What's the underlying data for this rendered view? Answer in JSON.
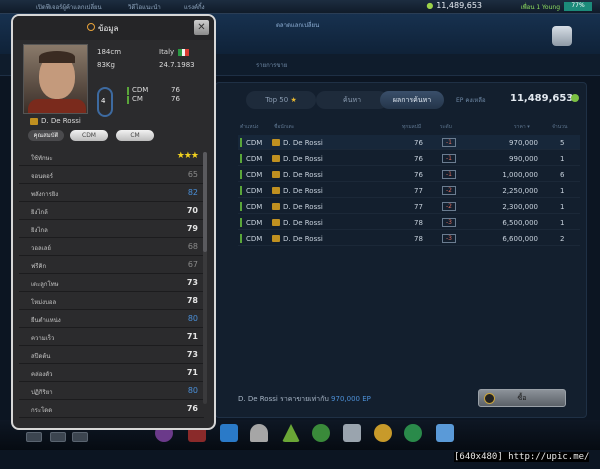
{
  "topbar": {
    "nav_left": "เปิดฟีเจอร์ผู้ค้าแลกเปลี่ยน",
    "nav_mid": "วิดีโอแนะนำ",
    "nav_right": "แรงค์กิ้ง",
    "coins": "11,489,653",
    "user": "เพื่อน 1 Young",
    "percent": "77%"
  },
  "header": {
    "title": "ตลาดแลกเปลี่ยน"
  },
  "subbar": {
    "label": "รายการขาย"
  },
  "popup": {
    "title": "ข้อมูล",
    "close": "✕",
    "player": {
      "name": "D. De Rossi",
      "height": "184cm",
      "weight": "83Kg",
      "country": "Italy",
      "birth": "24.7.1983",
      "number": "4",
      "pos1": "CDM",
      "pos1_val": "76",
      "pos2": "CM",
      "pos2_val": "76"
    },
    "tabs": [
      "คุณสมบัติ",
      "CDM",
      "CM"
    ],
    "stats": [
      {
        "label": "ใช้ทักษะ",
        "stars": "★★★"
      },
      {
        "label": "จอนตอร์",
        "value": "65",
        "style": "dim"
      },
      {
        "label": "พลังการยิง",
        "value": "82",
        "style": "blue"
      },
      {
        "label": "ยิงไกล้",
        "value": "70",
        "style": ""
      },
      {
        "label": "ยิงไกล",
        "value": "79",
        "style": ""
      },
      {
        "label": "วอลเลย์",
        "value": "68",
        "style": "dim"
      },
      {
        "label": "ฟรีคิก",
        "value": "67",
        "style": "dim"
      },
      {
        "label": "เตะลูกโทษ",
        "value": "73",
        "style": ""
      },
      {
        "label": "โหม่งบอล",
        "value": "78",
        "style": ""
      },
      {
        "label": "ยืนตำแหน่ง",
        "value": "80",
        "style": "blue"
      },
      {
        "label": "ความเร็ว",
        "value": "71",
        "style": ""
      },
      {
        "label": "สปีดต้น",
        "value": "73",
        "style": ""
      },
      {
        "label": "คล่องตัว",
        "value": "71",
        "style": ""
      },
      {
        "label": "ปฏิกิริยา",
        "value": "80",
        "style": "blue"
      },
      {
        "label": "กระโดด",
        "value": "76",
        "style": ""
      }
    ]
  },
  "market": {
    "tabs": [
      "Top 50",
      "ค้นหา",
      "ผลการค้นหา"
    ],
    "ep_label": "EP คงเหลือ",
    "ep_value": "11,489,653",
    "columns": [
      "ตำแหน่ง",
      "ชื่อนักเตะ",
      "ทุกมลปมี",
      "ระดับ",
      "ราคา ▾",
      "จำนวน"
    ],
    "rows": [
      {
        "pos": "CDM",
        "name": "D. De Rossi",
        "ovr": "76",
        "grade": "-1",
        "price": "970,000",
        "qty": "5"
      },
      {
        "pos": "CDM",
        "name": "D. De Rossi",
        "ovr": "76",
        "grade": "-1",
        "price": "990,000",
        "qty": "1"
      },
      {
        "pos": "CDM",
        "name": "D. De Rossi",
        "ovr": "76",
        "grade": "-1",
        "price": "1,000,000",
        "qty": "6"
      },
      {
        "pos": "CDM",
        "name": "D. De Rossi",
        "ovr": "77",
        "grade": "-2",
        "price": "2,250,000",
        "qty": "1"
      },
      {
        "pos": "CDM",
        "name": "D. De Rossi",
        "ovr": "77",
        "grade": "-2",
        "price": "2,300,000",
        "qty": "1"
      },
      {
        "pos": "CDM",
        "name": "D. De Rossi",
        "ovr": "78",
        "grade": "-3",
        "price": "6,500,000",
        "qty": "1"
      },
      {
        "pos": "CDM",
        "name": "D. De Rossi",
        "ovr": "78",
        "grade": "-3",
        "price": "6,600,000",
        "qty": "2"
      }
    ],
    "footer_text": "D. De Rossi ราคาขายเท่ากับ",
    "footer_amount": "970,000 EP",
    "buy_label": "ซื้อ"
  },
  "watermark": "[640x480] http://upic.me/"
}
